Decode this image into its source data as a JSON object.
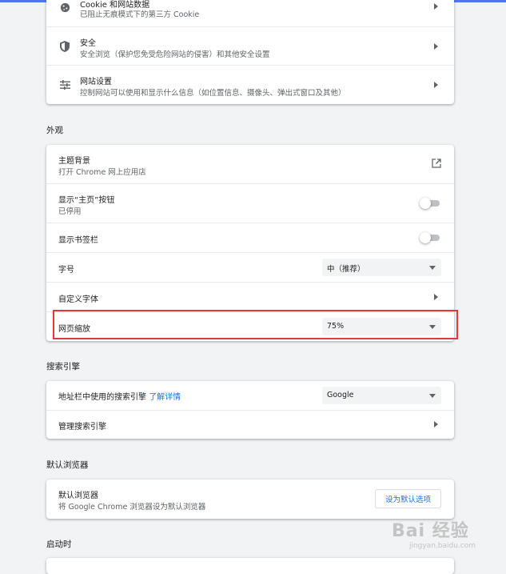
{
  "privacy": {
    "rows": [
      {
        "title": "Cookie 和网站数据",
        "subtitle": "已阻止无痕模式下的第三方 Cookie",
        "icon": "cookie-icon"
      },
      {
        "title": "安全",
        "subtitle": "安全浏览（保护您免受危险网站的侵害）和其他安全设置",
        "icon": "shield-icon"
      },
      {
        "title": "网站设置",
        "subtitle": "控制网站可以使用和显示什么信息（如位置信息、摄像头、弹出式窗口及其他）",
        "icon": "sliders-icon"
      }
    ]
  },
  "appearance": {
    "section_title": "外观",
    "theme": {
      "title": "主题背景",
      "subtitle": "打开 Chrome 网上应用店"
    },
    "home_button": {
      "title": "显示“主页”按钮",
      "subtitle": "已停用"
    },
    "bookmarks_bar": {
      "title": "显示书签栏"
    },
    "font_size": {
      "title": "字号",
      "value": "中（推荐）"
    },
    "custom_fonts": {
      "title": "自定义字体"
    },
    "page_zoom": {
      "title": "网页缩放",
      "value": "75%"
    }
  },
  "search": {
    "section_title": "搜索引擎",
    "address_bar": {
      "title": "地址栏中使用的搜索引擎",
      "link": "了解详情",
      "value": "Google"
    },
    "manage": {
      "title": "管理搜索引擎"
    }
  },
  "default_browser": {
    "section_title": "默认浏览器",
    "title": "默认浏览器",
    "subtitle": "将 Google Chrome 浏览器设为默认浏览器",
    "button": "设为默认选项"
  },
  "startup": {
    "section_title": "启动时"
  },
  "watermark": {
    "line1": "Bai 经验",
    "line2": "jingyan.baidu.com"
  },
  "colors": {
    "accent": "#1a73e8",
    "highlight": "#e53935",
    "topbar": "#4a7be6"
  }
}
